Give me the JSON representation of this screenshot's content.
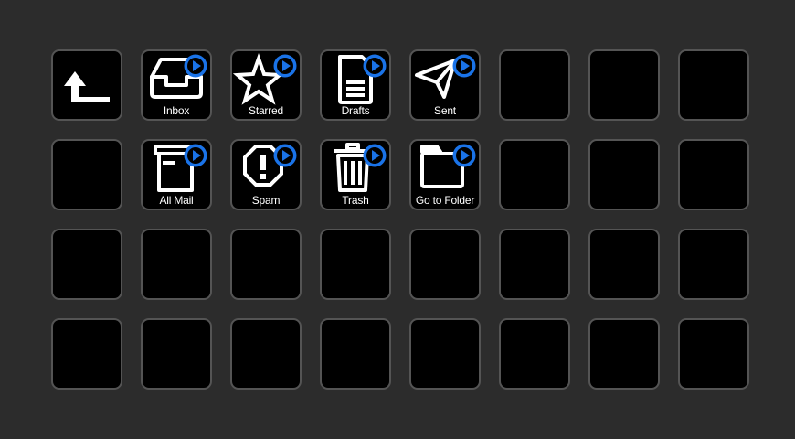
{
  "colors": {
    "background": "#2c2c2c",
    "key_fill": "#000000",
    "key_border": "#545454",
    "icon": "#ffffff",
    "badge": "#1a73e8"
  },
  "keys": {
    "back": {
      "icon": "back-arrow-icon"
    },
    "inbox": {
      "label": "Inbox",
      "icon": "inbox-icon"
    },
    "starred": {
      "label": "Starred",
      "icon": "star-icon"
    },
    "drafts": {
      "label": "Drafts",
      "icon": "document-icon"
    },
    "sent": {
      "label": "Sent",
      "icon": "paper-plane-icon"
    },
    "all_mail": {
      "label": "All Mail",
      "icon": "archive-icon"
    },
    "spam": {
      "label": "Spam",
      "icon": "spam-octagon-icon"
    },
    "trash": {
      "label": "Trash",
      "icon": "trash-icon"
    },
    "folder": {
      "label": "Go to Folder",
      "icon": "folder-icon"
    }
  }
}
